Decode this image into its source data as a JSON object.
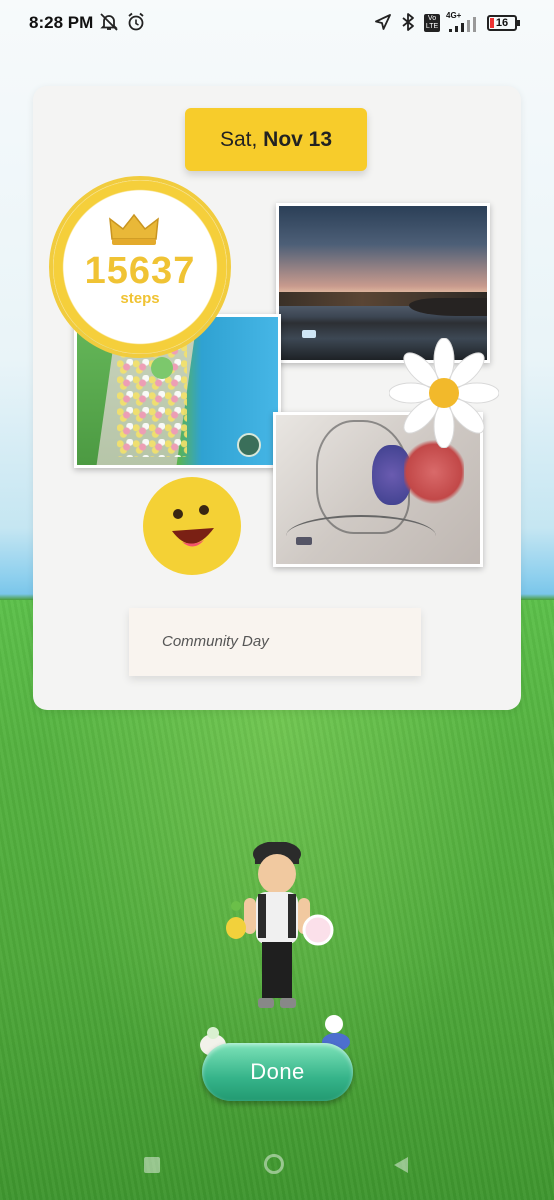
{
  "status_bar": {
    "time": "8:28 PM",
    "icons": [
      "mute-vibrate-icon",
      "alarm-icon",
      "location-icon",
      "bluetooth-icon",
      "volte-icon",
      "4g-signal-icon"
    ],
    "network": "4G+",
    "volte": "Vo LTE",
    "battery": "16"
  },
  "journal_card": {
    "date_prefix": "Sat, ",
    "date_main": "Nov 13",
    "steps_value": "15637",
    "steps_unit": "steps",
    "caption": "Community Day",
    "photos": [
      "flower-path-photo",
      "sunset-beach-photo",
      "sketch-art-photo"
    ],
    "stickers": [
      "crown-icon",
      "daisy-sticker",
      "smiley-sticker"
    ]
  },
  "actions": {
    "done_label": "Done"
  },
  "nav_bar": {
    "icons": [
      "recent-apps-icon",
      "home-icon",
      "back-icon"
    ]
  },
  "colors": {
    "accent_yellow": "#f7cc2b",
    "done_green": "#36b48a",
    "battery_low": "#e33333"
  }
}
